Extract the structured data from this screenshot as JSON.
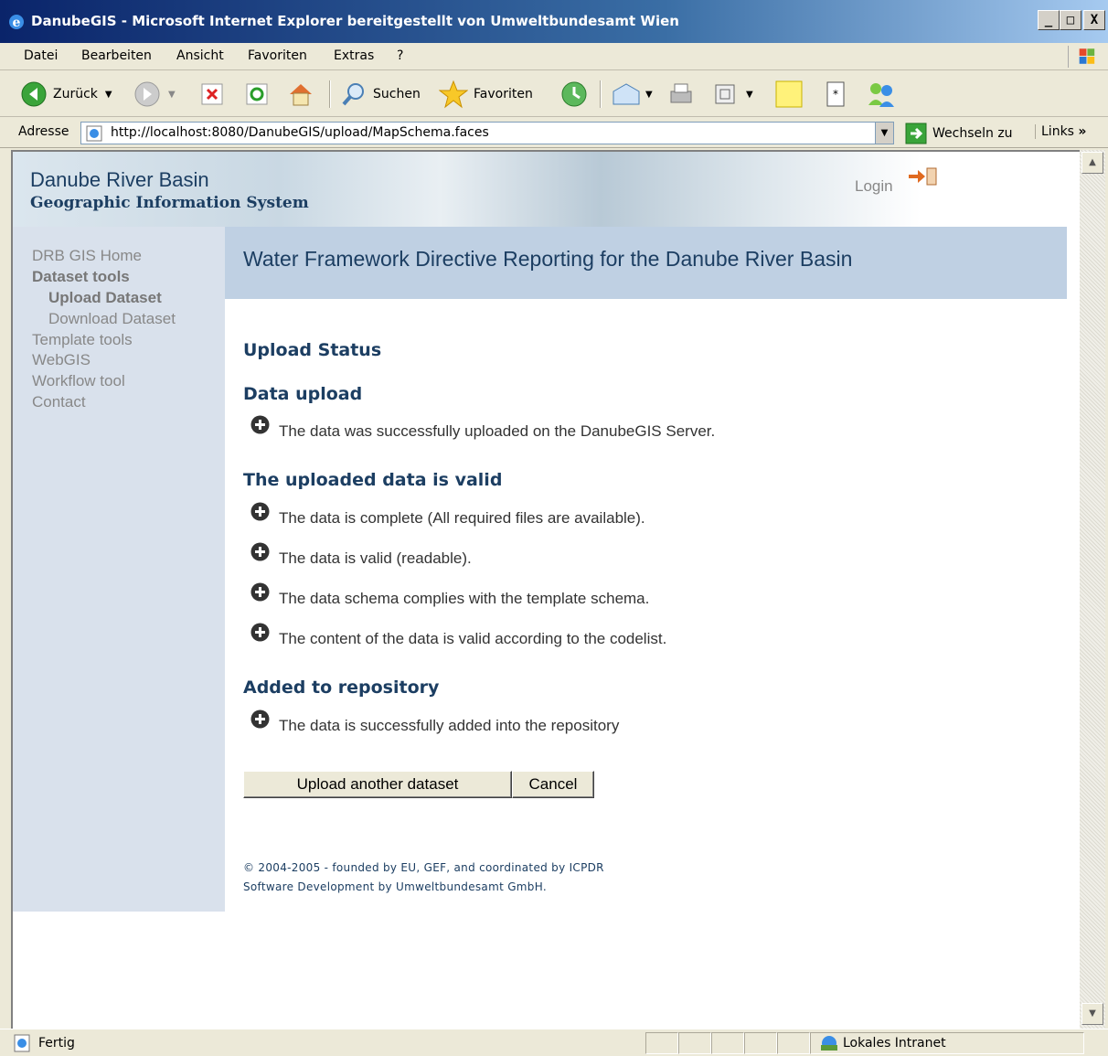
{
  "window": {
    "title": "DanubeGIS - Microsoft Internet Explorer bereitgestellt von Umweltbundesamt Wien",
    "min_label": "_",
    "max_label": "□",
    "close_label": "X"
  },
  "menu": {
    "items": [
      {
        "label": "Datei"
      },
      {
        "label": "Bearbeiten"
      },
      {
        "label": "Ansicht"
      },
      {
        "label": "Favoriten"
      },
      {
        "label": "Extras"
      },
      {
        "label": "?"
      }
    ]
  },
  "toolbar": {
    "back_label": "Zurück",
    "search_label": "Suchen",
    "favorites_label": "Favoriten"
  },
  "address": {
    "label": "Adresse",
    "url": "http://localhost:8080/DanubeGIS/upload/MapSchema.faces",
    "go_label": "Wechseln zu",
    "links_label": "Links"
  },
  "site": {
    "title": "Danube River Basin",
    "subtitle": "Geographic Information System",
    "login_label": "Login"
  },
  "nav": [
    {
      "label": "DRB GIS Home"
    },
    {
      "label": "Dataset tools"
    },
    {
      "label": "Upload Dataset"
    },
    {
      "label": "Download Dataset"
    },
    {
      "label": "Template tools"
    },
    {
      "label": "WebGIS"
    },
    {
      "label": "Workflow tool"
    },
    {
      "label": "Contact"
    }
  ],
  "main": {
    "title": "Water Framework Directive Reporting for the Danube River Basin",
    "upload_status_heading": "Upload Status",
    "sections": [
      {
        "heading": "Data upload",
        "items": [
          "The data was successfully uploaded on the DanubeGIS Server."
        ]
      },
      {
        "heading": "The uploaded data is valid",
        "items": [
          "The data is complete (All required files are available).",
          "The data is valid (readable).",
          "The data schema complies with the template schema.",
          "The content of the data is valid according to the codelist."
        ]
      },
      {
        "heading": "Added to repository",
        "items": [
          "The data is successfully added into the repository"
        ]
      }
    ],
    "upload_another_label": "Upload another dataset",
    "cancel_label": "Cancel",
    "footer_line1": "© 2004-2005 - founded by EU, GEF, and coordinated by ICPDR",
    "footer_line2": "Software Development by Umweltbundesamt GmbH."
  },
  "statusbar": {
    "status": "Fertig",
    "zone": "Lokales Intranet"
  },
  "colors": {
    "title_bar": "#0a246a",
    "sidebar": "#d9e1ec",
    "header_band": "#bfd0e3",
    "heading_text": "#1c3e62"
  }
}
